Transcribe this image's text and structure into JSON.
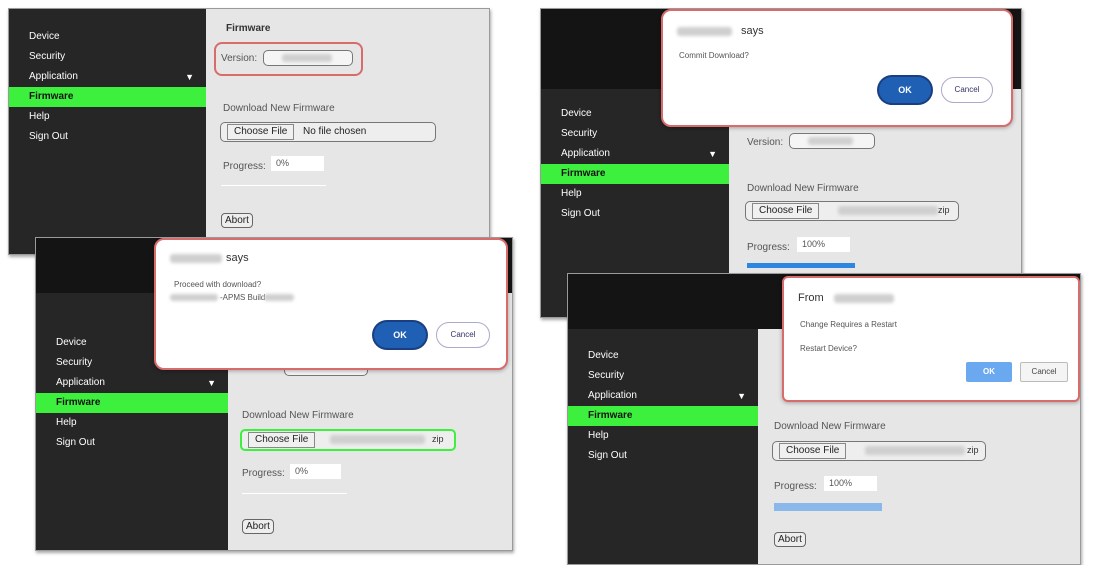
{
  "nav": {
    "items": [
      "Device",
      "Security",
      "Application",
      "Firmware",
      "Help",
      "Sign Out"
    ],
    "active": "Firmware",
    "expand_glyph": "▼"
  },
  "firmware": {
    "section_title": "Firmware",
    "version_label": "Version:",
    "download_label": "Download New Firmware",
    "choose_file": "Choose File",
    "no_file": "No file chosen",
    "zip_suffix": "zip",
    "progress_label": "Progress:",
    "abort": "Abort"
  },
  "panels": {
    "p1": {
      "progress": "0%"
    },
    "p2": {
      "progress": "0%"
    },
    "p3": {
      "progress": "100%"
    },
    "p4": {
      "progress": "100%"
    }
  },
  "dialogs": {
    "proceed": {
      "title": "says",
      "message": "Proceed with download?",
      "detail": "-APMS Build",
      "ok": "OK",
      "cancel": "Cancel"
    },
    "commit": {
      "title": "says",
      "message": "Commit Download?",
      "ok": "OK",
      "cancel": "Cancel"
    },
    "restart": {
      "title": "From",
      "message1": "Change Requires a Restart",
      "message2": "Restart Device?",
      "ok": "OK",
      "cancel": "Cancel"
    }
  },
  "colors": {
    "active_nav": "#3ef03e",
    "progress_fill": "#2f86e0",
    "progress_fill_faded": "#8bb8ea",
    "highlight": "#d86b6b",
    "ok_button": "#1f5fb4",
    "restart_ok": "#6aa8f0"
  }
}
